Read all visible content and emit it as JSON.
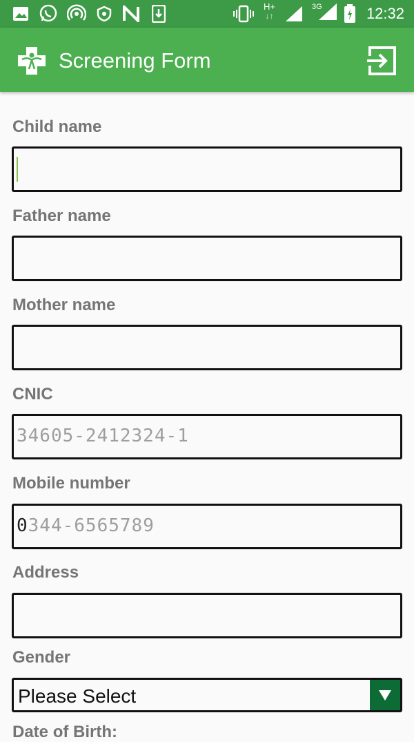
{
  "status_bar": {
    "time": "12:32",
    "network_label_1": "H+",
    "network_label_2": "3G",
    "left_icons": [
      "gallery-icon",
      "whatsapp-icon",
      "hotspot-icon",
      "shield-icon",
      "n-app-icon",
      "download-icon"
    ],
    "right_icons": [
      "vibrate-icon",
      "data-arrows-icon",
      "signal-icon",
      "signal-3g-icon",
      "battery-charging-icon"
    ]
  },
  "app_bar": {
    "title": "Screening Form",
    "logo_icon": "medical-logo-icon",
    "logout_icon": "logout-icon"
  },
  "form": {
    "child_name": {
      "label": "Child name",
      "value": "",
      "placeholder": ""
    },
    "father_name": {
      "label": "Father name",
      "value": "",
      "placeholder": ""
    },
    "mother_name": {
      "label": "Mother name",
      "value": "",
      "placeholder": ""
    },
    "cnic": {
      "label": "CNIC",
      "value": "",
      "placeholder": "34605-2412324-1"
    },
    "mobile": {
      "label": "Mobile number",
      "typed": "0",
      "placeholder_rest": "344-6565789"
    },
    "address": {
      "label": "Address",
      "value": "",
      "placeholder": ""
    },
    "gender": {
      "label": "Gender",
      "selected": "Please Select"
    },
    "dob": {
      "label": "Date of Birth:"
    }
  },
  "colors": {
    "status_bar": "#3d9a46",
    "app_bar": "#4caf50",
    "select_arrow": "#0d6b35",
    "label": "#757575"
  }
}
